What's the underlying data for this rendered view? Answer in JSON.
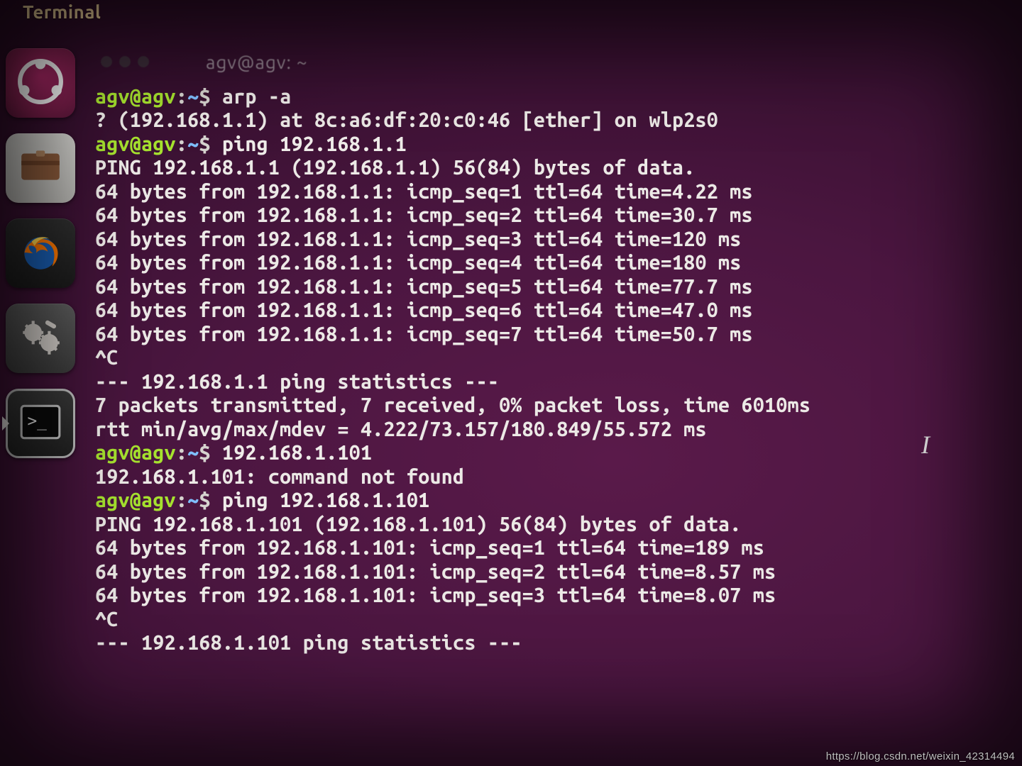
{
  "app_label": "Terminal",
  "tab_title": "agv@agv: ~",
  "launcher": {
    "items": [
      {
        "id": "ubuntu-dash",
        "name": "ubuntu-dash-icon"
      },
      {
        "id": "files",
        "name": "files-icon"
      },
      {
        "id": "firefox",
        "name": "firefox-icon"
      },
      {
        "id": "settings",
        "name": "settings-icon"
      },
      {
        "id": "terminal",
        "name": "terminal-icon",
        "active": true
      }
    ]
  },
  "prompt": {
    "userhost": "agv@agv",
    "sep": ":",
    "path": "~",
    "sigil": "$"
  },
  "session": {
    "entries": [
      {
        "type": "prompt",
        "cmd": "arp -a"
      },
      {
        "type": "out",
        "text": "? (192.168.1.1) at 8c:a6:df:20:c0:46 [ether] on wlp2s0"
      },
      {
        "type": "prompt",
        "cmd": "ping 192.168.1.1"
      },
      {
        "type": "out",
        "text": "PING 192.168.1.1 (192.168.1.1) 56(84) bytes of data."
      },
      {
        "type": "out",
        "text": "64 bytes from 192.168.1.1: icmp_seq=1 ttl=64 time=4.22 ms"
      },
      {
        "type": "out",
        "text": "64 bytes from 192.168.1.1: icmp_seq=2 ttl=64 time=30.7 ms"
      },
      {
        "type": "out",
        "text": "64 bytes from 192.168.1.1: icmp_seq=3 ttl=64 time=120 ms"
      },
      {
        "type": "out",
        "text": "64 bytes from 192.168.1.1: icmp_seq=4 ttl=64 time=180 ms"
      },
      {
        "type": "out",
        "text": "64 bytes from 192.168.1.1: icmp_seq=5 ttl=64 time=77.7 ms"
      },
      {
        "type": "out",
        "text": "64 bytes from 192.168.1.1: icmp_seq=6 ttl=64 time=47.0 ms"
      },
      {
        "type": "out",
        "text": "64 bytes from 192.168.1.1: icmp_seq=7 ttl=64 time=50.7 ms"
      },
      {
        "type": "out",
        "text": "^C"
      },
      {
        "type": "out",
        "text": "--- 192.168.1.1 ping statistics ---"
      },
      {
        "type": "out",
        "text": "7 packets transmitted, 7 received, 0% packet loss, time 6010ms"
      },
      {
        "type": "out",
        "text": "rtt min/avg/max/mdev = 4.222/73.157/180.849/55.572 ms"
      },
      {
        "type": "prompt",
        "cmd": "192.168.1.101"
      },
      {
        "type": "out",
        "text": "192.168.1.101: command not found"
      },
      {
        "type": "prompt",
        "cmd": "ping 192.168.1.101"
      },
      {
        "type": "out",
        "text": "PING 192.168.1.101 (192.168.1.101) 56(84) bytes of data."
      },
      {
        "type": "out",
        "text": "64 bytes from 192.168.1.101: icmp_seq=1 ttl=64 time=189 ms"
      },
      {
        "type": "out",
        "text": "64 bytes from 192.168.1.101: icmp_seq=2 ttl=64 time=8.57 ms"
      },
      {
        "type": "out",
        "text": "64 bytes from 192.168.1.101: icmp_seq=3 ttl=64 time=8.07 ms"
      },
      {
        "type": "out",
        "text": "^C"
      },
      {
        "type": "out",
        "text": "--- 192.168.1.101 ping statistics ---"
      }
    ]
  },
  "colors": {
    "userhost": "#a6e22e",
    "path": "#7fbfff",
    "text": "#efece9",
    "bg": "#3a1132"
  },
  "watermark": "https://blog.csdn.net/weixin_42314494"
}
